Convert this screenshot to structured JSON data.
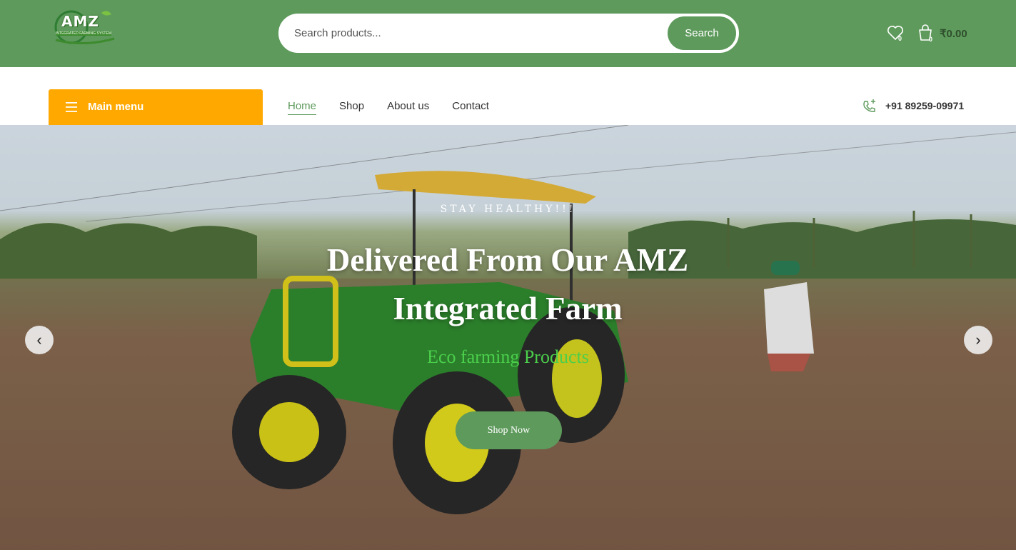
{
  "header": {
    "logo_text": "AMZ",
    "logo_subtext": "INTEGRATED FARMING SYSTEM",
    "search_placeholder": "Search products...",
    "search_button": "Search",
    "wishlist_count": "0",
    "cart_count": "0",
    "cart_total": "₹0.00"
  },
  "nav": {
    "main_menu": "Main menu",
    "links": [
      "Home",
      "Shop",
      "About us",
      "Contact"
    ],
    "active_index": 0,
    "phone": "+91 89259-09971"
  },
  "hero": {
    "kicker": "STAY HEALTHY!!!",
    "headline": "Delivered From Our AMZ Integrated Farm",
    "subline": "Eco farming Products",
    "cta": "Shop Now",
    "prev_arrow": "‹",
    "next_arrow": "›"
  },
  "colors": {
    "brand_green": "#5e9a5c",
    "menu_orange": "#ffa800",
    "sub_green": "#4bcf4b"
  },
  "icons": [
    "heart-icon",
    "cart-icon",
    "hamburger-icon",
    "phone-icon",
    "chevron-left-icon",
    "chevron-right-icon"
  ]
}
